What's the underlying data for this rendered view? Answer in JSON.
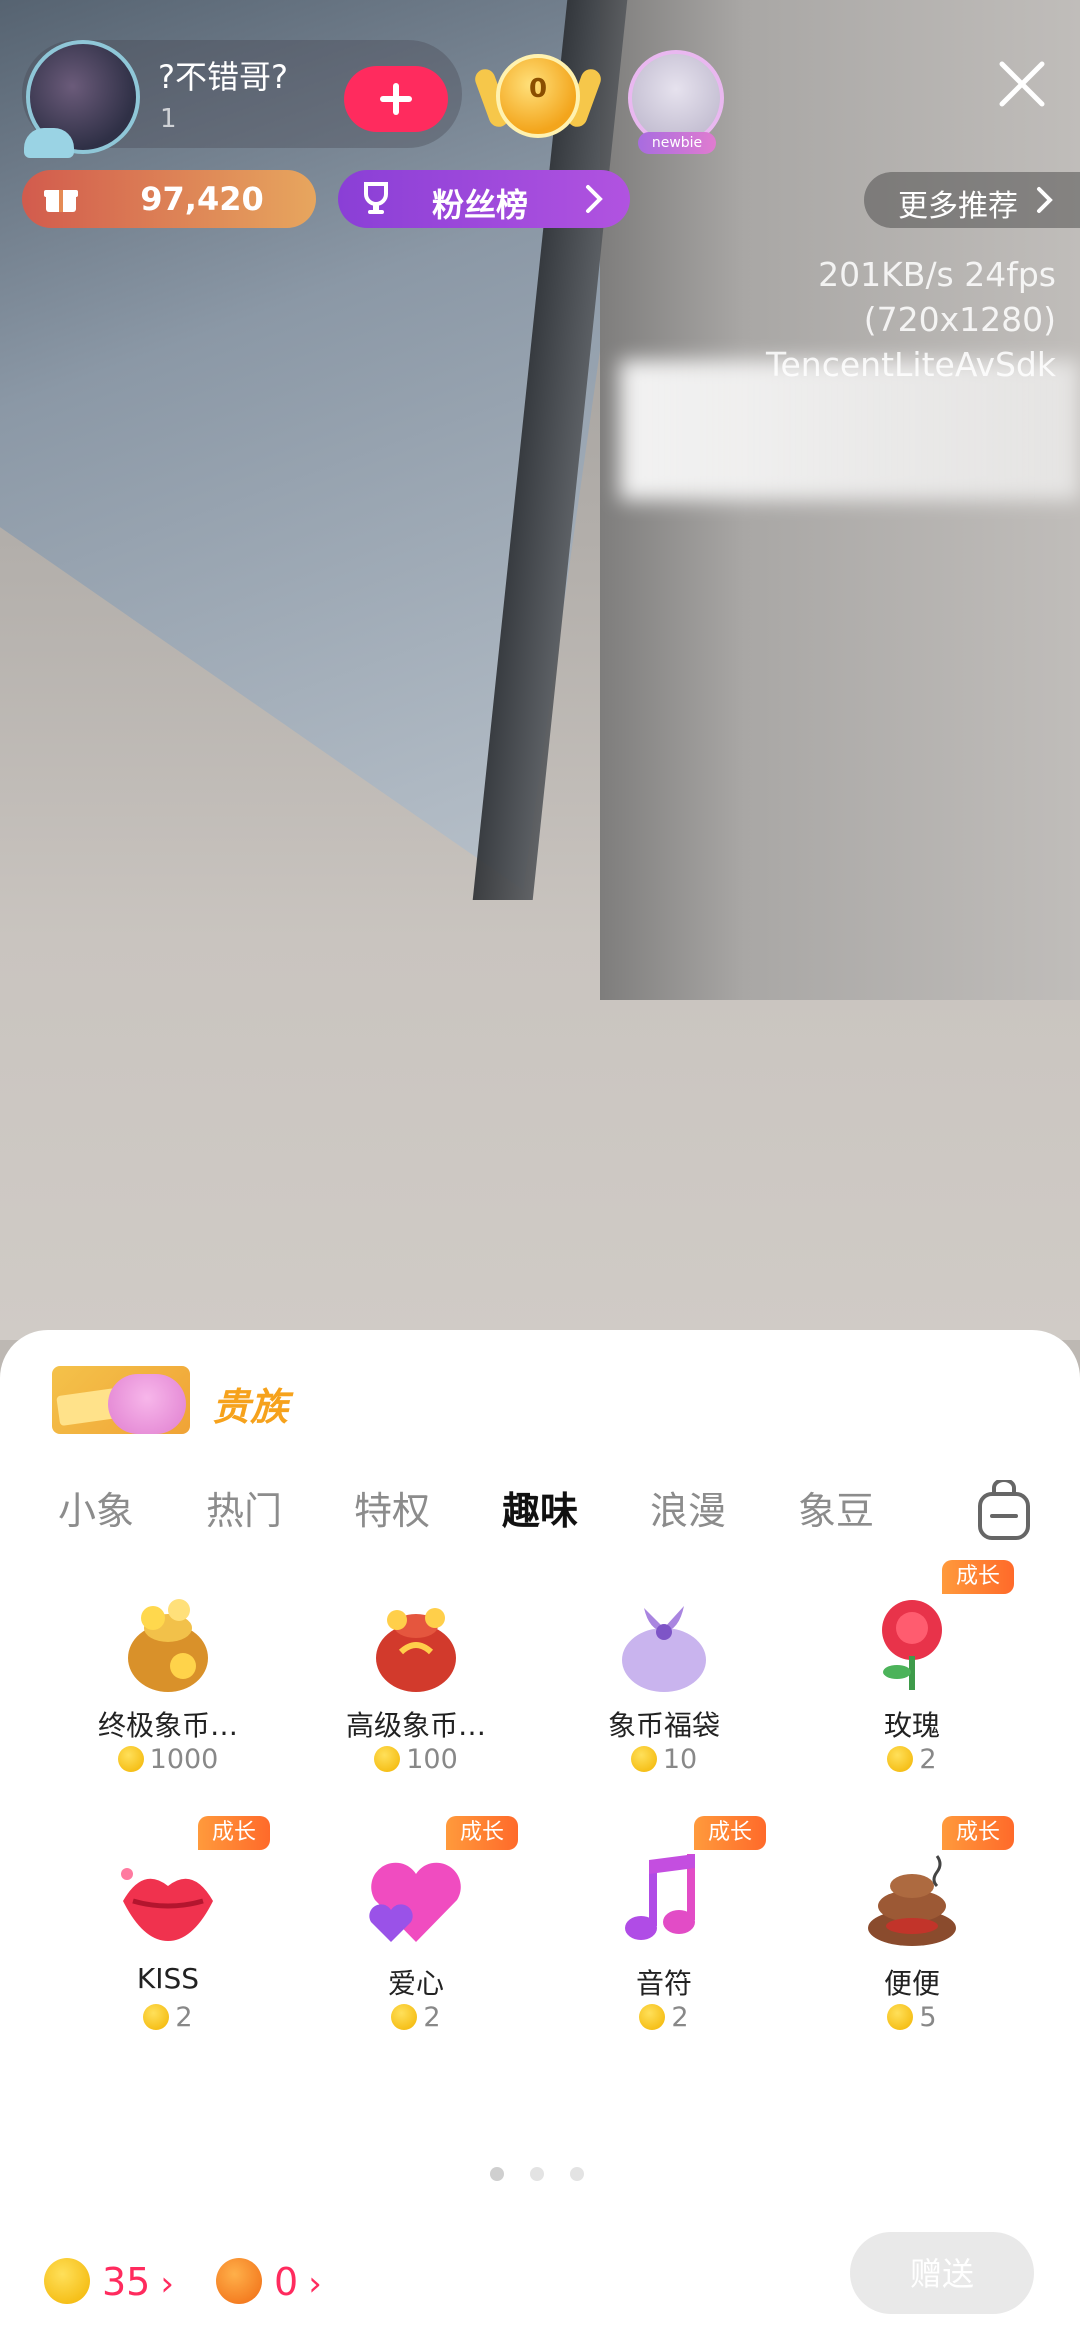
{
  "host": {
    "name": "?不错哥?",
    "viewer_count": "1",
    "follow_label": "+"
  },
  "header": {
    "medal_level": "0",
    "newbie_tag": "newbie",
    "gift_total": "97,420",
    "fans_rank_label": "粉丝榜",
    "more_recommend_label": "更多推荐"
  },
  "stream_stats": {
    "bitrate": "201KB/s 24fps",
    "resolution": "(720x1280)",
    "sdk": "TencentLiteAvSdk"
  },
  "gift_panel": {
    "banner_text": "贵族",
    "tabs": [
      {
        "label": "小象",
        "active": false
      },
      {
        "label": "热门",
        "active": false
      },
      {
        "label": "特权",
        "active": false
      },
      {
        "label": "趣味",
        "active": true
      },
      {
        "label": "浪漫",
        "active": false
      },
      {
        "label": "象豆",
        "active": false
      }
    ],
    "gifts": [
      {
        "name": "终极象币…",
        "price": "1000",
        "badge": "",
        "icon": "gold-coin-bag-icon"
      },
      {
        "name": "高级象币…",
        "price": "100",
        "badge": "",
        "icon": "red-coin-bag-icon"
      },
      {
        "name": "象币福袋",
        "price": "10",
        "badge": "",
        "icon": "purple-lucky-bag-icon"
      },
      {
        "name": "玫瑰",
        "price": "2",
        "badge": "成长",
        "icon": "rose-icon"
      },
      {
        "name": "KISS",
        "price": "2",
        "badge": "成长",
        "icon": "lips-icon"
      },
      {
        "name": "爱心",
        "price": "2",
        "badge": "成长",
        "icon": "heart-icon"
      },
      {
        "name": "音符",
        "price": "2",
        "badge": "成长",
        "icon": "music-note-icon"
      },
      {
        "name": "便便",
        "price": "5",
        "badge": "成长",
        "icon": "poop-icon"
      }
    ],
    "page_count": 3,
    "active_page": 1
  },
  "footer": {
    "coin_balance": "35",
    "bean_balance": "0",
    "send_label": "赠送"
  },
  "colors": {
    "accent": "#ff2b5e",
    "badge": "#ff7a2e",
    "coin": "#f2b300"
  }
}
